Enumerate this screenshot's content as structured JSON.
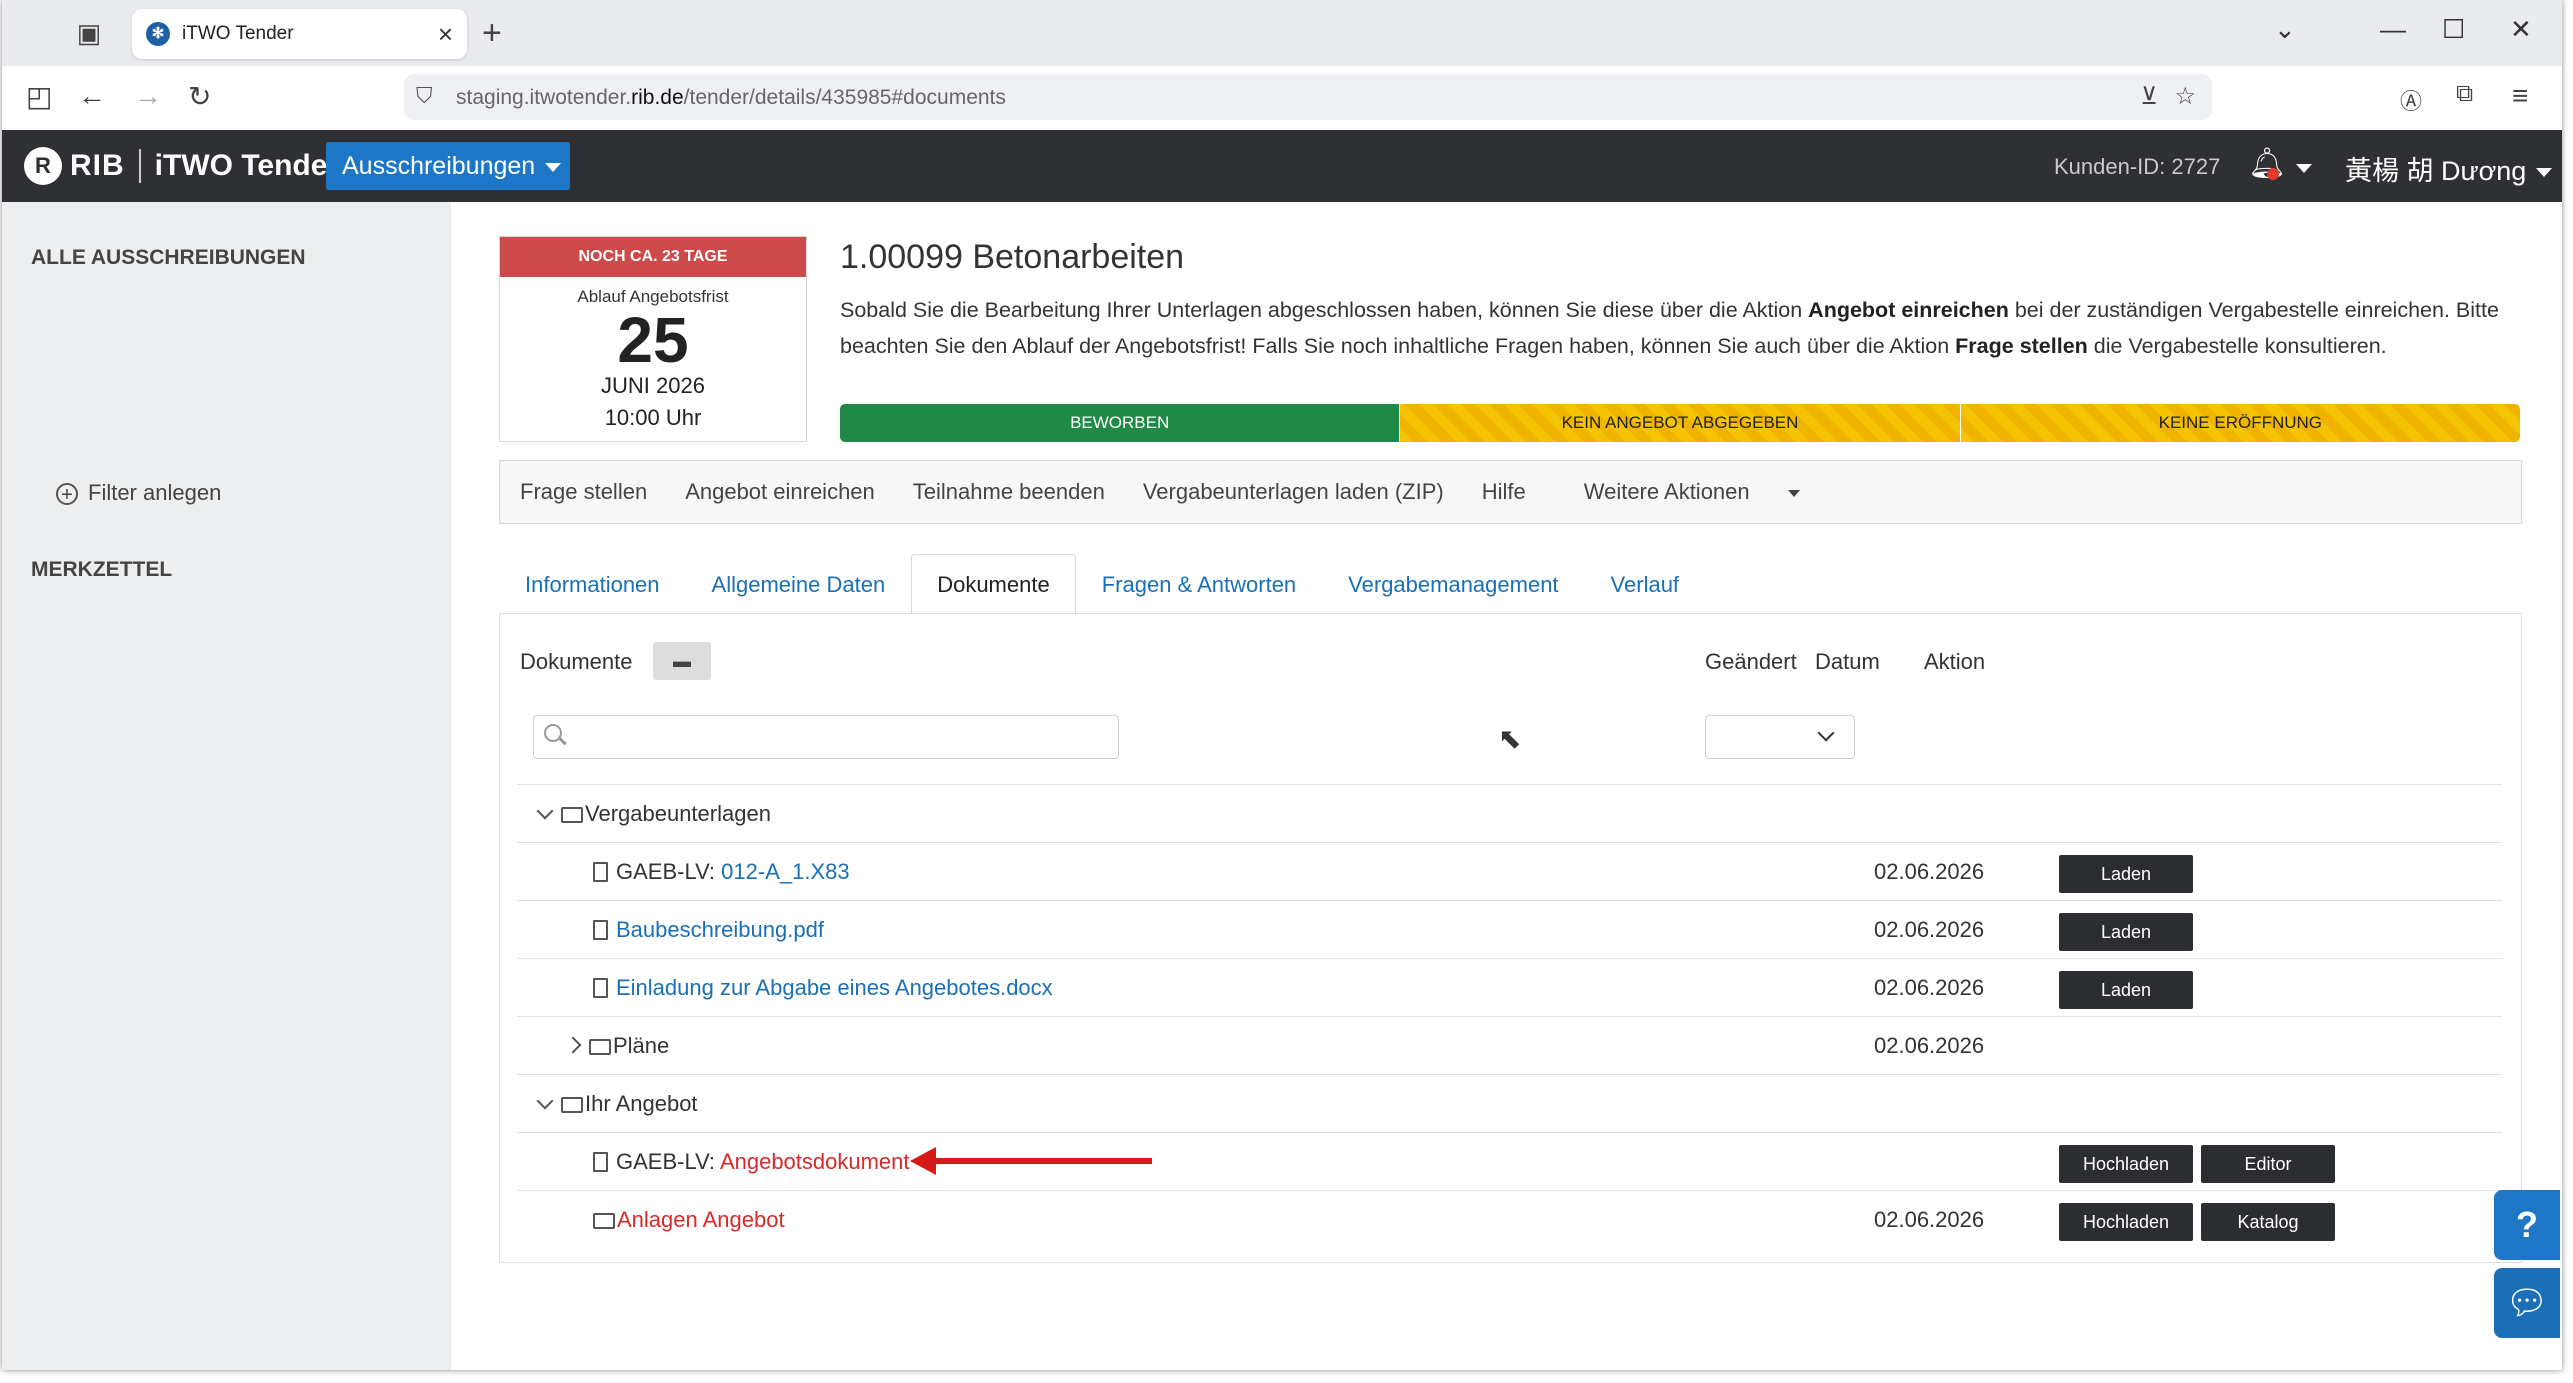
{
  "browser": {
    "tab_title": "iTWO Tender",
    "url_prefix": "staging.itwotender.",
    "url_domain": "rib.de",
    "url_path": "/tender/details/435985#documents"
  },
  "app": {
    "logo_rib": "RIB",
    "logo_product": "iTWO Tender",
    "nav_button": "Ausschreibungen",
    "customer_id": "Kunden-ID: 2727",
    "user_name": "黃楊 胡 Dương"
  },
  "sidebar": {
    "all_tenders": "ALLE AUSSCHREIBUNGEN",
    "add_filter": "Filter anlegen",
    "watchlist": "MERKZETTEL"
  },
  "deadline": {
    "badge": "NOCH CA. 23 TAGE",
    "label": "Ablauf Angebotsfrist",
    "day": "25",
    "month_year": "JUNI 2026",
    "time": "10:00 Uhr"
  },
  "tender": {
    "title": "1.00099 Betonarbeiten",
    "desc_1": "Sobald Sie die Bearbeitung Ihrer Unterlagen abgeschlossen haben, können Sie diese über die Aktion ",
    "desc_b1": "Angebot einreichen",
    "desc_2": " bei der zuständigen Vergabestelle einreichen. Bitte beachten Sie den Ablauf der Angebotsfrist! Falls Sie noch inhaltliche Fragen haben, können Sie auch über die Aktion ",
    "desc_b2": "Frage stellen",
    "desc_3": " die Vergabestelle konsultieren."
  },
  "status": {
    "step1": "BEWORBEN",
    "step2": "KEIN ANGEBOT ABGEGEBEN",
    "step3": "KEINE ERÖFFNUNG",
    "colors": {
      "done": "#1e8a46",
      "pending": "#f4c400"
    }
  },
  "actions": {
    "ask": "Frage stellen",
    "submit": "Angebot einreichen",
    "end": "Teilnahme beenden",
    "download": "Vergabeunterlagen laden (ZIP)",
    "help": "Hilfe",
    "more": "Weitere Aktionen"
  },
  "tabs": {
    "info": "Informationen",
    "general": "Allgemeine Daten",
    "documents": "Dokumente",
    "qa": "Fragen & Antworten",
    "management": "Vergabemanagement",
    "history": "Verlauf"
  },
  "docs": {
    "col_documents": "Dokumente",
    "col_changed": "Geändert",
    "col_date": "Datum",
    "col_action": "Aktion",
    "search_placeholder": "",
    "rows": [
      {
        "name": "Vergabeunterlagen",
        "date": ""
      },
      {
        "prefix": "GAEB-LV: ",
        "name": "012-A_1.X83",
        "date": "02.06.2026",
        "btn1": "Laden"
      },
      {
        "name": "Baubeschreibung.pdf",
        "date": "02.06.2026",
        "btn1": "Laden"
      },
      {
        "name": "Einladung zur Abgabe eines Angebotes.docx",
        "date": "02.06.2026",
        "btn1": "Laden"
      },
      {
        "name": "Pläne",
        "date": "02.06.2026"
      },
      {
        "name": "Ihr Angebot",
        "date": ""
      },
      {
        "prefix": "GAEB-LV: ",
        "name": "Angebotsdokument",
        "date": "",
        "btn1": "Hochladen",
        "btn2": "Editor"
      },
      {
        "name": "Anlagen Angebot",
        "date": "02.06.2026",
        "btn1": "Hochladen",
        "btn2": "Katalog"
      }
    ]
  }
}
